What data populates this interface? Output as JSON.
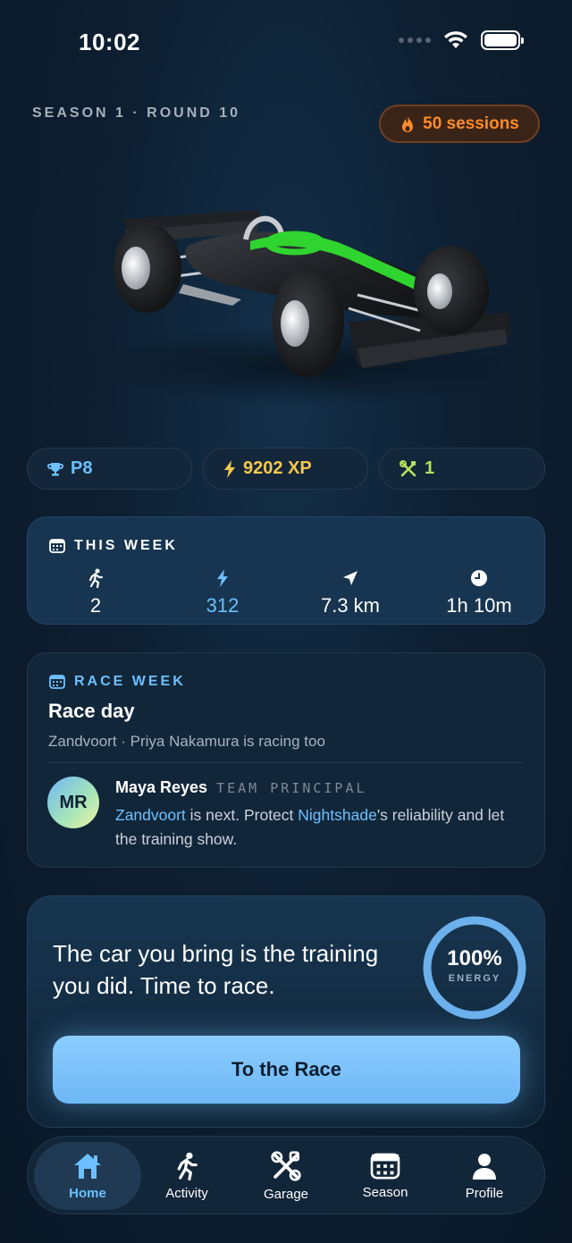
{
  "status_bar": {
    "time": "10:02"
  },
  "header": {
    "season_round": "SEASON 1 · ROUND 10",
    "sessions": "50 sessions"
  },
  "car": {
    "icon": "formula-car-illustration",
    "accent": "#2fd42f"
  },
  "stats": {
    "position": "P8",
    "xp": "9202 XP",
    "upgrades": "1"
  },
  "this_week": {
    "title": "THIS WEEK",
    "metrics": [
      {
        "icon": "runner-icon",
        "value": "2"
      },
      {
        "icon": "bolt-icon",
        "value": "312"
      },
      {
        "icon": "navigation-arrow-icon",
        "value": "7.3 km"
      },
      {
        "icon": "clock-icon",
        "value": "1h 10m"
      }
    ]
  },
  "race_week": {
    "label": "RACE WEEK",
    "title": "Race day",
    "subtitle": "Zandvoort · Priya Nakamura is racing too",
    "principal": {
      "initials": "MR",
      "name": "Maya Reyes",
      "role": "TEAM PRINCIPAL",
      "message_parts": [
        {
          "text": "Zandvoort",
          "highlight": true
        },
        {
          "text": " is next. Protect ",
          "highlight": false
        },
        {
          "text": "Nightshade",
          "highlight": true
        },
        {
          "text": "'s reliability and let the training show.",
          "highlight": false
        }
      ]
    }
  },
  "cta": {
    "message": "The car you bring is the training you did. Time to race.",
    "energy_percent": 100,
    "energy_value": "100%",
    "energy_label": "ENERGY",
    "button_label": "To the Race"
  },
  "tabs": [
    {
      "label": "Home",
      "icon": "home-icon",
      "active": true
    },
    {
      "label": "Activity",
      "icon": "runner-icon",
      "active": false
    },
    {
      "label": "Garage",
      "icon": "tools-icon",
      "active": false
    },
    {
      "label": "Season",
      "icon": "calendar-icon",
      "active": false
    },
    {
      "label": "Profile",
      "icon": "person-icon",
      "active": false
    }
  ],
  "colors": {
    "accent_blue": "#6cc0ff",
    "xp_yellow": "#f5c84a",
    "upgrade_green": "#b6e35a",
    "flame_orange": "#ff8a2a"
  }
}
